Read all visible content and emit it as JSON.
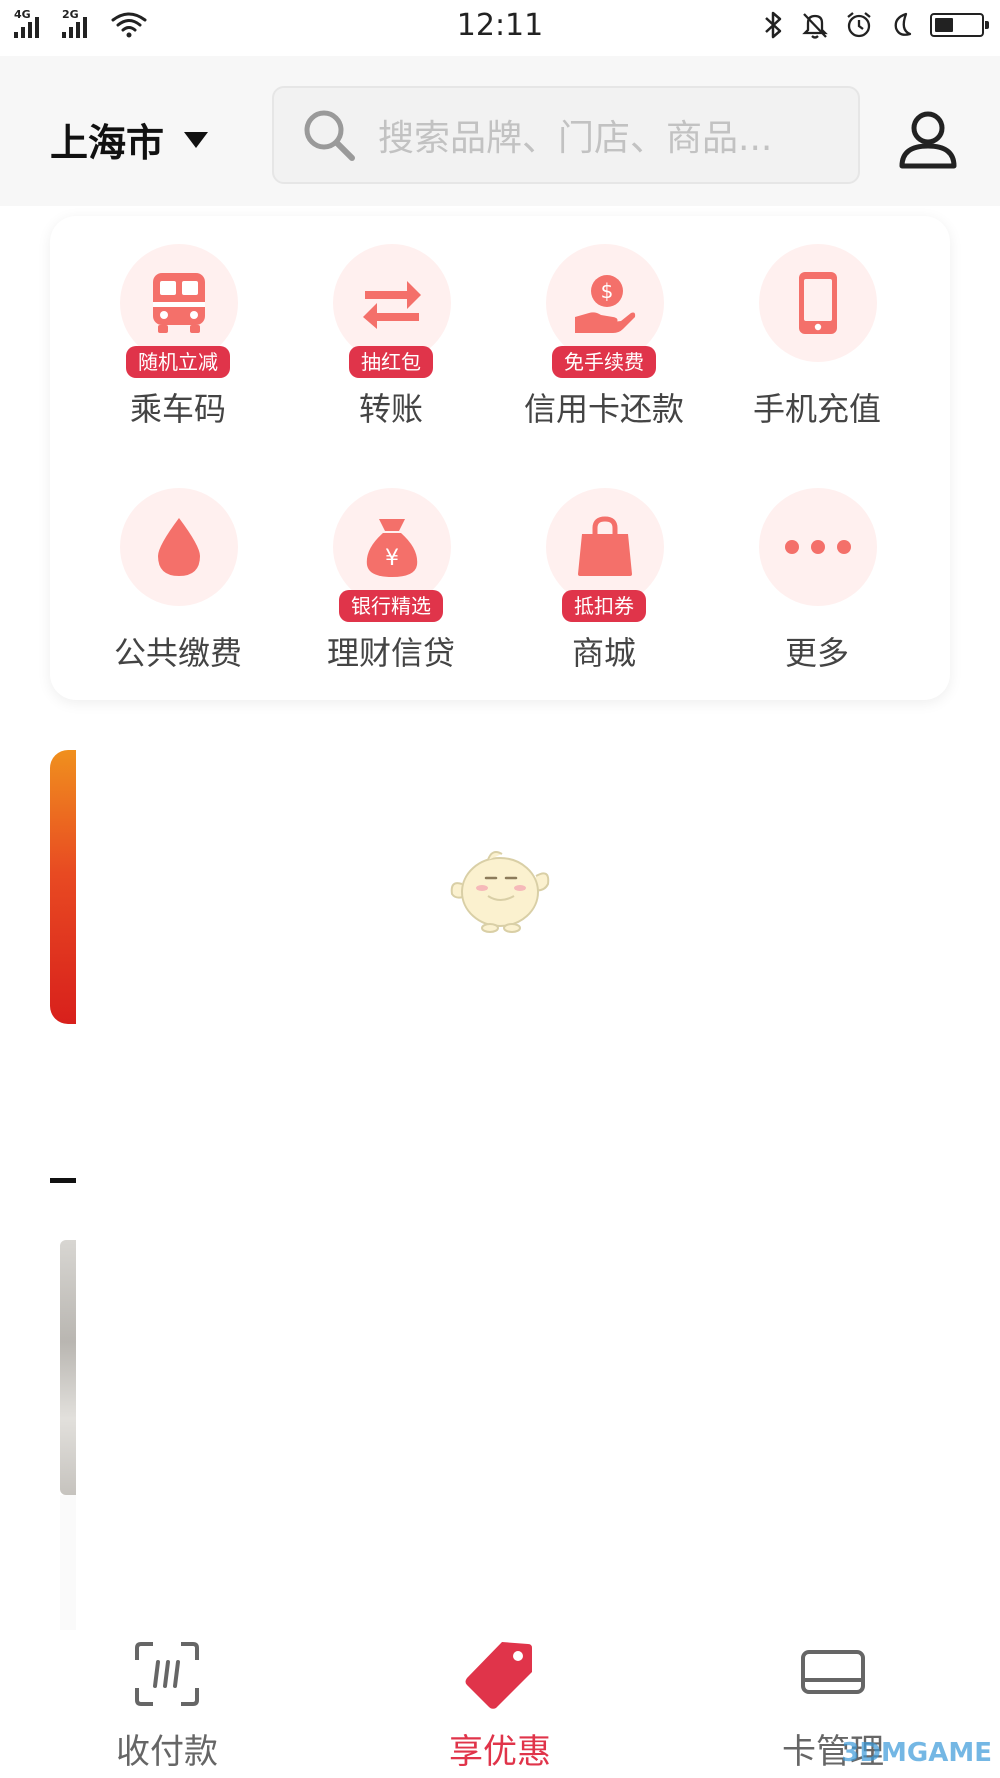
{
  "status_bar": {
    "network_1": "4G",
    "network_2": "2G",
    "time": "12:11",
    "battery_level": 0.4
  },
  "header": {
    "city": "上海市",
    "search_placeholder": "搜索品牌、门店、商品..."
  },
  "services": [
    {
      "icon": "bus-icon",
      "label": "乘车码",
      "badge": "随机立减"
    },
    {
      "icon": "transfer-arrows-icon",
      "label": "转账",
      "badge": "抽红包"
    },
    {
      "icon": "hand-coin-icon",
      "label": "信用卡还款",
      "badge": "免手续费"
    },
    {
      "icon": "mobile-phone-icon",
      "label": "手机充值",
      "badge": ""
    },
    {
      "icon": "water-drop-icon",
      "label": "公共缴费",
      "badge": ""
    },
    {
      "icon": "money-bag-icon",
      "label": "理财信贷",
      "badge": "银行精选"
    },
    {
      "icon": "shopping-bag-icon",
      "label": "商城",
      "badge": "抵扣券"
    },
    {
      "icon": "more-dots-icon",
      "label": "更多",
      "badge": ""
    }
  ],
  "bottom_nav": [
    {
      "icon": "scan-pay-icon",
      "label": "收付款",
      "active": false
    },
    {
      "icon": "price-tag-icon",
      "label": "享优惠",
      "active": true
    },
    {
      "icon": "card-icon",
      "label": "卡管理",
      "active": false
    }
  ],
  "colors": {
    "accent": "#e0344a",
    "icon_fill": "#f4706a",
    "icon_bg": "#fff0ef",
    "nav_active": "#e0344a",
    "nav_inactive": "#666666"
  },
  "watermark": "3DMGAME"
}
